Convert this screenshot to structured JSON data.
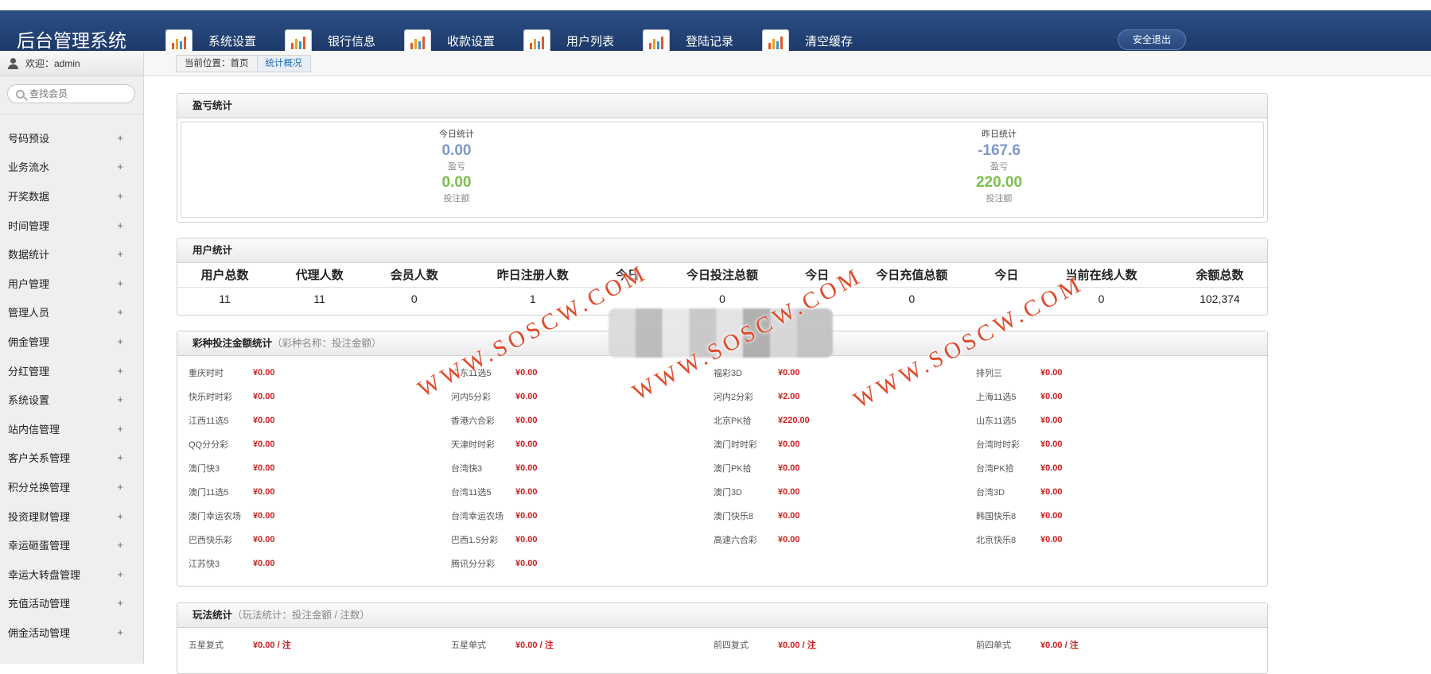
{
  "brand": "后台管理系统",
  "nav": [
    "系统设置",
    "银行信息",
    "收款设置",
    "用户列表",
    "登陆记录",
    "清空缓存"
  ],
  "logout": "安全退出",
  "sidebar": {
    "welcome": "欢迎：admin",
    "search_placeholder": "查找会员",
    "items": [
      "号码预设",
      "业务流水",
      "开奖数据",
      "时间管理",
      "数据统计",
      "用户管理",
      "管理人员",
      "佣金管理",
      "分红管理",
      "系统设置",
      "站内信管理",
      "客户关系管理",
      "积分兑换管理",
      "投资理财管理",
      "幸运砸蛋管理",
      "幸运大转盘管理",
      "充值活动管理",
      "佣金活动管理"
    ]
  },
  "breadcrumb": {
    "prefix": "当前位置：首页",
    "current": "统计概况"
  },
  "profit": {
    "title": "盈亏统计",
    "today": {
      "title": "今日统计",
      "profit": "0.00",
      "profit_label": "盈亏",
      "bet": "0.00",
      "bet_label": "投注额"
    },
    "yesterday": {
      "title": "昨日统计",
      "profit": "-167.6",
      "profit_label": "盈亏",
      "bet": "220.00",
      "bet_label": "投注额"
    }
  },
  "users": {
    "title": "用户统计",
    "headers": [
      "用户总数",
      "代理人数",
      "会员人数",
      "昨日注册人数",
      "今日",
      "今日投注总额",
      "今日",
      "今日充值总额",
      "今日",
      "当前在线人数",
      "余额总数"
    ],
    "values": [
      "11",
      "11",
      "0",
      "1",
      "",
      "0",
      "",
      "0",
      "",
      "0",
      "102,374"
    ]
  },
  "lottery": {
    "title": "彩种投注金额统计",
    "subtitle": "（彩种名称：投注金额）",
    "items": [
      [
        "重庆时时",
        "¥0.00"
      ],
      [
        "广东11选5",
        "¥0.00"
      ],
      [
        "福彩3D",
        "¥0.00"
      ],
      [
        "排列三",
        "¥0.00"
      ],
      [
        "快乐时时彩",
        "¥0.00"
      ],
      [
        "河内5分彩",
        "¥0.00"
      ],
      [
        "河内2分彩",
        "¥2.00"
      ],
      [
        "上海11选5",
        "¥0.00"
      ],
      [
        "江西11选5",
        "¥0.00"
      ],
      [
        "香港六合彩",
        "¥0.00"
      ],
      [
        "北京PK拾",
        "¥220.00"
      ],
      [
        "山东11选5",
        "¥0.00"
      ],
      [
        "QQ分分彩",
        "¥0.00"
      ],
      [
        "天津时时彩",
        "¥0.00"
      ],
      [
        "澳门时时彩",
        "¥0.00"
      ],
      [
        "台湾时时彩",
        "¥0.00"
      ],
      [
        "澳门快3",
        "¥0.00"
      ],
      [
        "台湾快3",
        "¥0.00"
      ],
      [
        "澳门PK拾",
        "¥0.00"
      ],
      [
        "台湾PK拾",
        "¥0.00"
      ],
      [
        "澳门11选5",
        "¥0.00"
      ],
      [
        "台湾11选5",
        "¥0.00"
      ],
      [
        "澳门3D",
        "¥0.00"
      ],
      [
        "台湾3D",
        "¥0.00"
      ],
      [
        "澳门幸运农场",
        "¥0.00"
      ],
      [
        "台湾幸运农场",
        "¥0.00"
      ],
      [
        "澳门快乐8",
        "¥0.00"
      ],
      [
        "韩国快乐8",
        "¥0.00"
      ],
      [
        "巴西快乐彩",
        "¥0.00"
      ],
      [
        "巴西1.5分彩",
        "¥0.00"
      ],
      [
        "高速六合彩",
        "¥0.00"
      ],
      [
        "北京快乐8",
        "¥0.00"
      ],
      [
        "江苏快3",
        "¥0.00"
      ],
      [
        "腾讯分分彩",
        "¥0.00"
      ]
    ]
  },
  "play": {
    "title": "玩法统计",
    "subtitle": "（玩法统计：投注金额 / 注数）",
    "items": [
      [
        "五星复式",
        "¥0.00 / 注"
      ],
      [
        "五星单式",
        "¥0.00 / 注"
      ],
      [
        "前四复式",
        "¥0.00 / 注"
      ],
      [
        "前四单式",
        "¥0.00 / 注"
      ]
    ]
  },
  "watermark": "WWW.SOSCW.COM"
}
